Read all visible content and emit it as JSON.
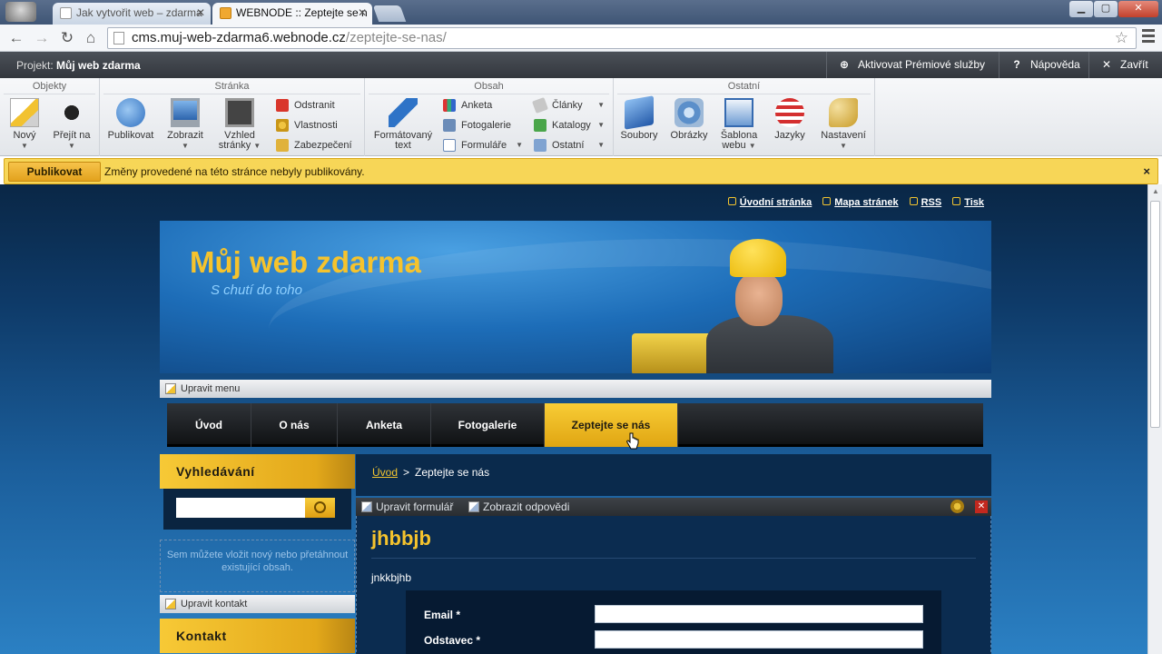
{
  "browser": {
    "tabs": [
      {
        "label": "Jak vytvořit web – zdarma",
        "active": false
      },
      {
        "label": "WEBNODE :: Zeptejte se n",
        "active": true
      }
    ],
    "url_host": "cms.muj-web-zdarma6.webnode.cz",
    "url_path": "/zeptejte-se-nas/"
  },
  "adminbar": {
    "project_label": "Projekt:",
    "project_name": "Můj web zdarma",
    "premium": "Aktivovat Prémiové služby",
    "help": "Nápověda",
    "close": "Zavřít"
  },
  "ribbon": {
    "groups": {
      "objekty": "Objekty",
      "stranka": "Stránka",
      "obsah": "Obsah",
      "ostatni": "Ostatní"
    },
    "buttons": {
      "novy": "Nový",
      "prejit": "Přejít na",
      "publikovat": "Publikovat",
      "zobrazit": "Zobrazit",
      "vzhled1": "Vzhled",
      "vzhled2": "stránky",
      "odstranit": "Odstranit",
      "vlastnosti": "Vlastnosti",
      "zabezpeceni": "Zabezpečení",
      "formatovany1": "Formátovaný",
      "formatovany2": "text",
      "anketa": "Anketa",
      "fotogalerie": "Fotogalerie",
      "formulare": "Formuláře",
      "clanky": "Články",
      "katalogy": "Katalogy",
      "ostatni": "Ostatní",
      "soubory": "Soubory",
      "obrazky": "Obrázky",
      "sablona1": "Šablona",
      "sablona2": "webu",
      "jazyky": "Jazyky",
      "nastaveni": "Nastavení"
    }
  },
  "notice": {
    "button": "Publikovat",
    "message": "Změny provedené na této stránce nebyly publikovány.",
    "close": "×"
  },
  "site": {
    "toplinks": [
      "Úvodní stránka",
      "Mapa stránek",
      "RSS",
      "Tisk"
    ],
    "title": "Můj web zdarma",
    "subtitle": "S chutí do toho",
    "edit_menu": "Upravit menu",
    "nav": [
      "Úvod",
      "O nás",
      "Anketa",
      "Fotogalerie",
      "Zeptejte se nás"
    ],
    "search_title": "Vyhledávání",
    "dropzone_text": "Sem můžete vložit nový nebo přetáhnout existující obsah.",
    "edit_contact": "Upravit kontakt",
    "contact_title": "Kontakt",
    "breadcrumb_home": "Úvod",
    "breadcrumb_sep": ">",
    "breadcrumb_current": "Zeptejte se nás",
    "edit_form": "Upravit formulář",
    "show_answers": "Zobrazit odpovědi",
    "form_title": "jhbbjb",
    "form_desc": "jnkkbjhb",
    "fields": [
      "Email *",
      "Odstavec *"
    ]
  },
  "colors": {
    "accent_yellow": "#f5c32d",
    "site_dark_blue": "#0b2c50",
    "notice_yellow": "#f7d657"
  }
}
